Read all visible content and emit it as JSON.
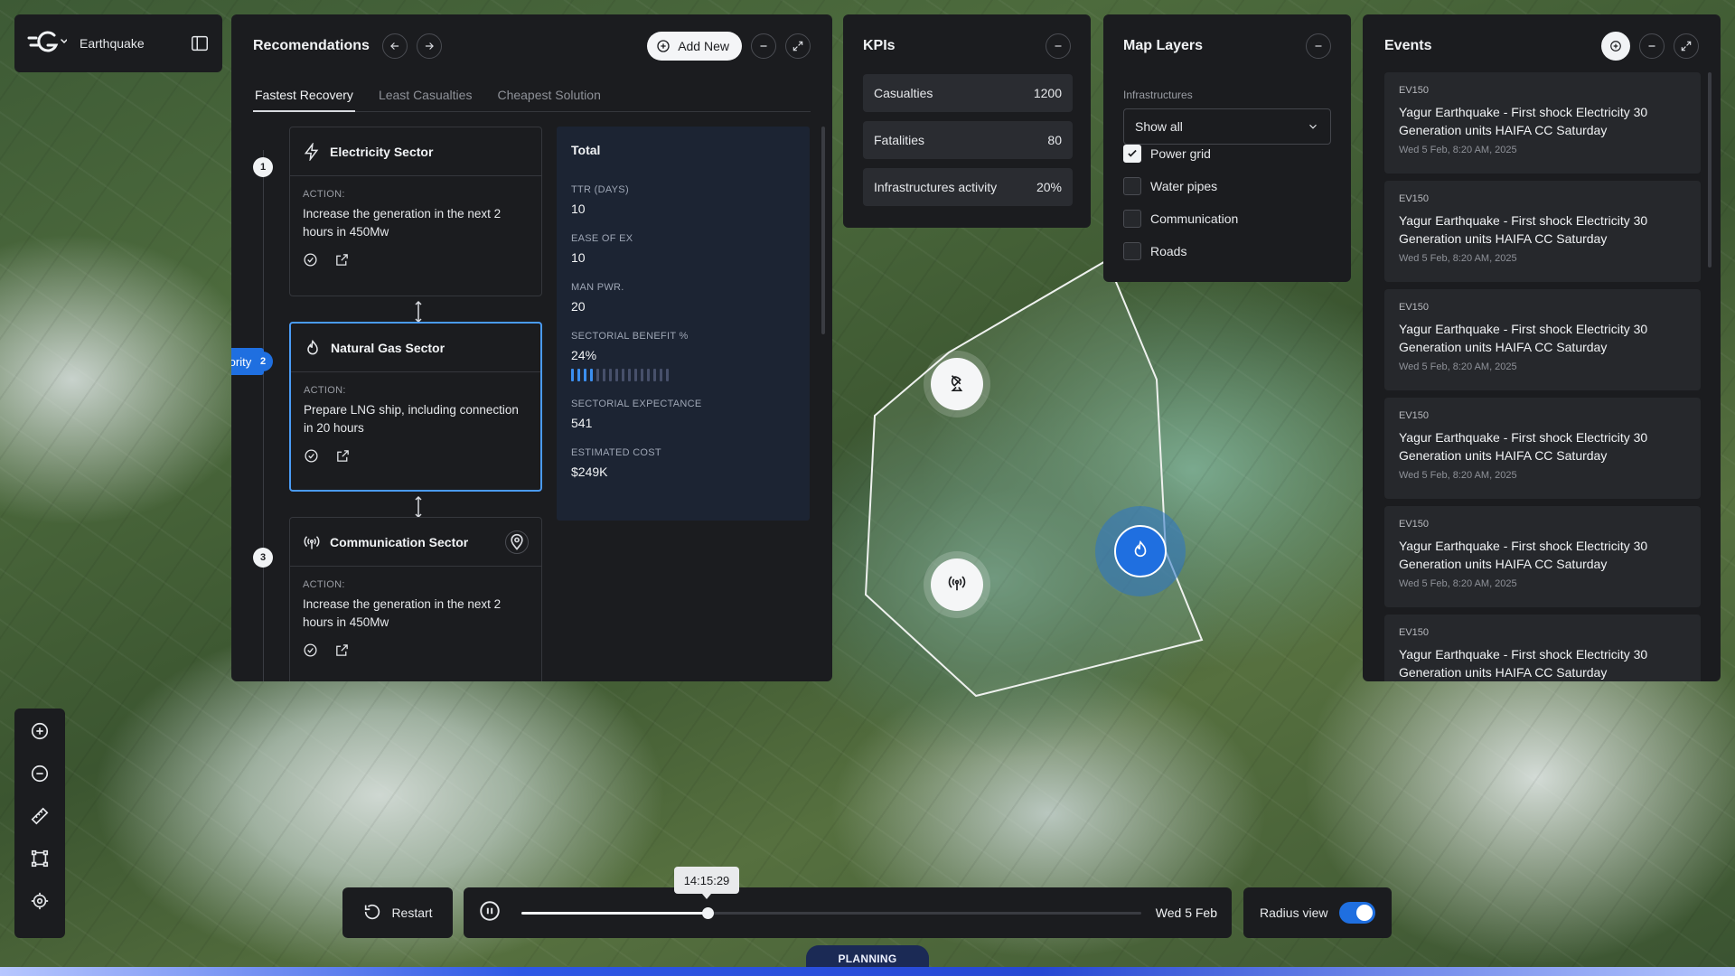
{
  "app": {
    "name": "Earthquake"
  },
  "recommendations": {
    "title": "Recomendations",
    "add_new": "Add New",
    "tabs": [
      {
        "label": "Fastest Recovery",
        "active": true
      },
      {
        "label": "Least Casualties",
        "active": false
      },
      {
        "label": "Cheapest Solution",
        "active": false
      }
    ],
    "priority_label": "Priority",
    "steps": [
      {
        "num": "1",
        "title": "Electricity Sector",
        "action_label": "ACTION:",
        "action": "Increase the generation in the next 2 hours in 450Mw",
        "icon": "lightning-icon"
      },
      {
        "num": "2",
        "title": "Natural Gas Sector",
        "action_label": "ACTION:",
        "action": "Prepare LNG ship, including connection in 20 hours",
        "icon": "flame-icon"
      },
      {
        "num": "3",
        "title": "Communication Sector",
        "action_label": "ACTION:",
        "action": "Increase the generation in the next 2 hours in 450Mw",
        "icon": "antenna-icon"
      }
    ],
    "total": {
      "title": "Total",
      "metrics": [
        {
          "label": "TTR (DAYS)",
          "value": "10"
        },
        {
          "label": "EASE OF EX",
          "value": "10"
        },
        {
          "label": "MAN PWR.",
          "value": "20"
        },
        {
          "label": "SECTORIAL BENEFIT %",
          "value": "24%",
          "bar_fraction": 0.24
        },
        {
          "label": "SECTORIAL EXPECTANCE",
          "value": "541"
        },
        {
          "label": "ESTIMATED COST",
          "value": "$249K"
        }
      ]
    }
  },
  "kpis": {
    "title": "KPIs",
    "rows": [
      {
        "label": "Casualties",
        "value": "1200"
      },
      {
        "label": "Fatalities",
        "value": "80"
      },
      {
        "label": "Infrastructures activity",
        "value": "20%"
      }
    ]
  },
  "map_layers": {
    "title": "Map Layers",
    "section_label": "Infrastructures",
    "select_value": "Show all",
    "options": [
      {
        "label": "Power grid",
        "checked": true
      },
      {
        "label": "Water pipes",
        "checked": false
      },
      {
        "label": "Communication",
        "checked": false
      },
      {
        "label": "Roads",
        "checked": false
      }
    ]
  },
  "events": {
    "title": "Events",
    "items": [
      {
        "code": "EV150",
        "text": "Yagur Earthquake - First shock Electricity 30 Generation units HAIFA CC Saturday",
        "date": "Wed 5 Feb, 8:20 AM, 2025"
      },
      {
        "code": "EV150",
        "text": "Yagur Earthquake - First shock Electricity 30 Generation units HAIFA CC Saturday",
        "date": "Wed 5 Feb, 8:20 AM, 2025"
      },
      {
        "code": "EV150",
        "text": "Yagur Earthquake - First shock Electricity 30 Generation units HAIFA CC Saturday",
        "date": "Wed 5 Feb, 8:20 AM, 2025"
      },
      {
        "code": "EV150",
        "text": "Yagur Earthquake - First shock Electricity 30 Generation units HAIFA CC Saturday",
        "date": "Wed 5 Feb, 8:20 AM, 2025"
      },
      {
        "code": "EV150",
        "text": "Yagur Earthquake - First shock Electricity 30 Generation units HAIFA CC Saturday",
        "date": "Wed 5 Feb, 8:20 AM, 2025"
      },
      {
        "code": "EV150",
        "text": "Yagur Earthquake - First shock Electricity 30 Generation units HAIFA CC Saturday",
        "date": ""
      }
    ]
  },
  "playback": {
    "restart_label": "Restart",
    "time": "14:15:29",
    "date": "Wed 5 Feb",
    "progress": 0.3,
    "radius_label": "Radius view",
    "radius_on": true
  },
  "mode": {
    "label": "PLANNING"
  },
  "colors": {
    "accent": "#1f6fe0",
    "panel": "#1b1c1f",
    "total_bg": "#1c2433"
  }
}
